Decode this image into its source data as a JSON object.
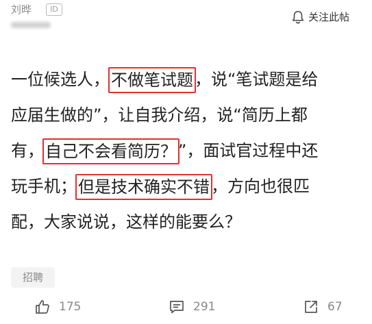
{
  "header": {
    "author": "刘晔",
    "id_badge": "ID",
    "follow_label": "关注此帖"
  },
  "post": {
    "lines": [
      {
        "pre": "一位候选人，",
        "hl": "不做笔试题",
        "post": "，说“笔试题是给"
      },
      {
        "pre": "应届生做的”，让自我介绍，说“简历上都",
        "hl": "",
        "post": ""
      },
      {
        "pre": "有，",
        "hl": "自己不会看简历？",
        "post": "”，面试官过程中还"
      },
      {
        "pre": "玩手机；",
        "hl": "但是技术确实不错",
        "post": "，方向也很匹"
      },
      {
        "pre": "配，大家说说，这样的能要么？",
        "hl": "",
        "post": ""
      }
    ]
  },
  "tag": "招聘",
  "actions": {
    "likes": "175",
    "comments": "291",
    "shares": "67"
  },
  "icons": {
    "follow": "bell-icon",
    "like": "thumbs-up-icon",
    "comment": "comment-icon",
    "share": "share-icon"
  },
  "colors": {
    "highlight_box": "#e0302e",
    "meta_text": "#8a8a8a",
    "body_text": "#222222"
  }
}
